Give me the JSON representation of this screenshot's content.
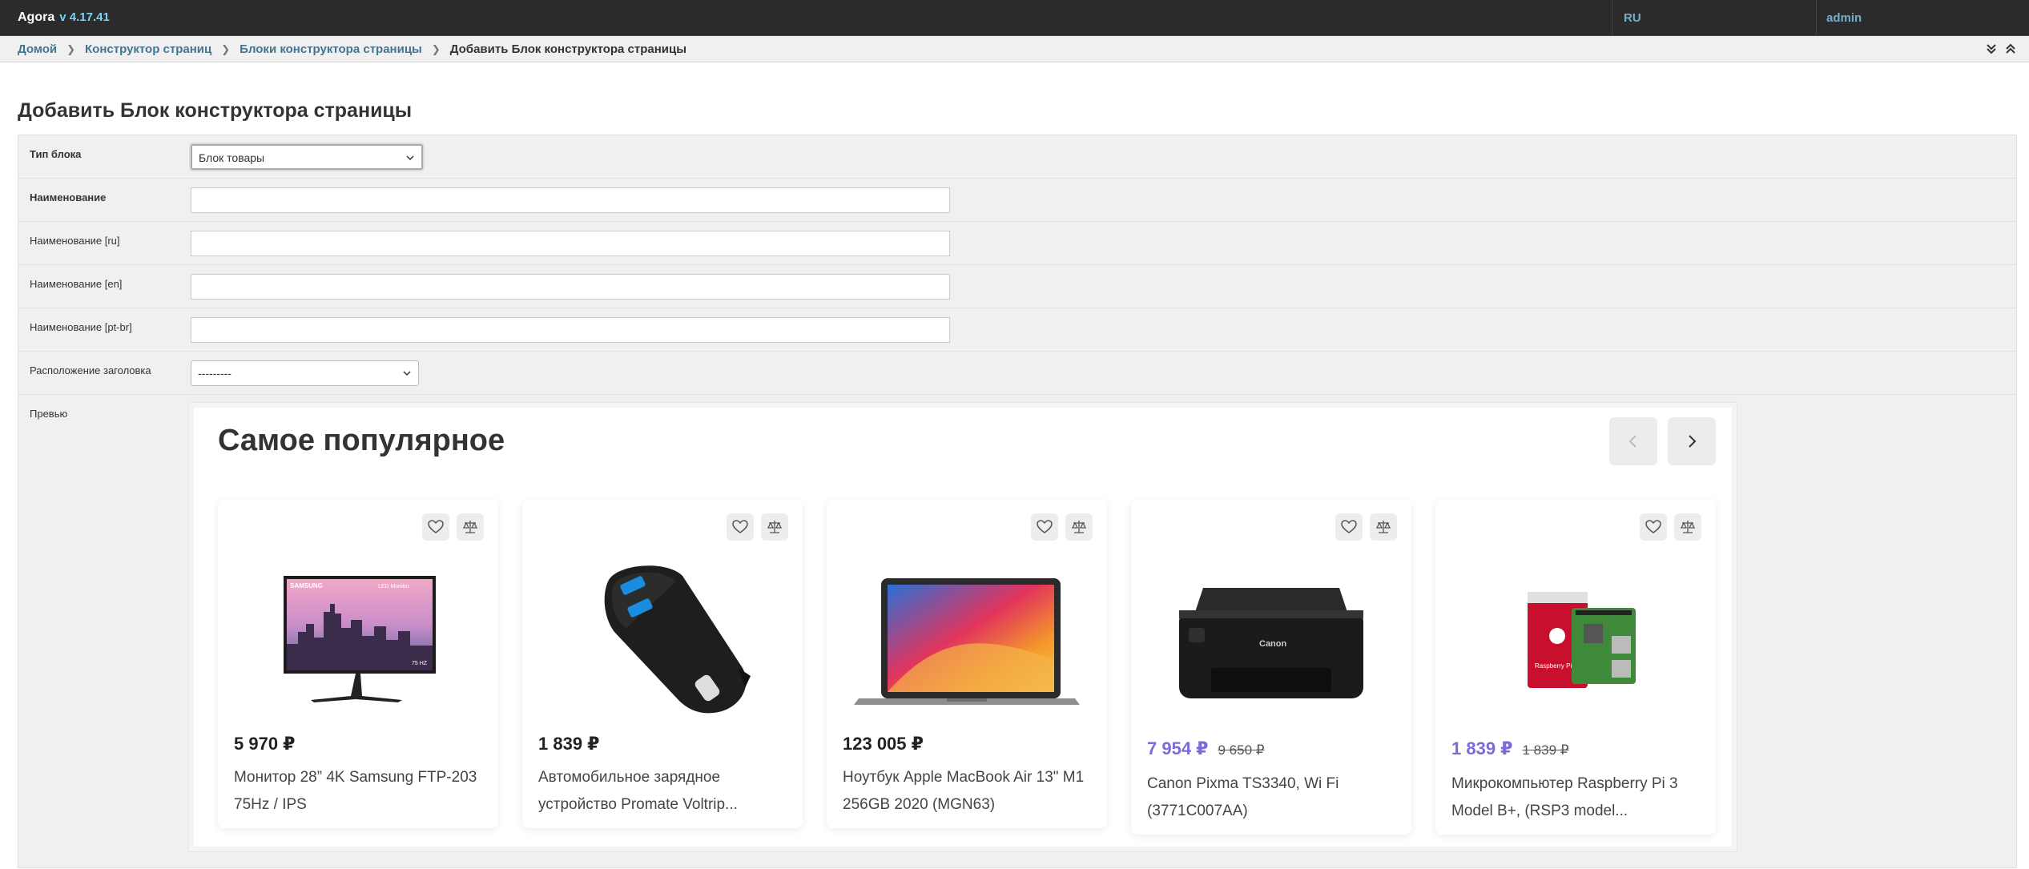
{
  "header": {
    "app": "Agora",
    "version": "v 4.17.41",
    "lang": "RU",
    "user": "admin"
  },
  "breadcrumbs": [
    "Домой",
    "Конструктор страниц",
    "Блоки конструктора страницы"
  ],
  "breadcrumb_current": "Добавить Блок конструктора страницы",
  "page_title": "Добавить Блок конструктора страницы",
  "form": {
    "block_type": {
      "label": "Тип блока",
      "value": "Блок товары"
    },
    "name": {
      "label": "Наименование",
      "value": ""
    },
    "name_ru": {
      "label": "Наименование [ru]",
      "value": ""
    },
    "name_en": {
      "label": "Наименование [en]",
      "value": ""
    },
    "name_ptbr": {
      "label": "Наименование [pt-br]",
      "value": ""
    },
    "title_position": {
      "label": "Расположение заголовка",
      "value": "---------"
    },
    "preview_label": "Превью"
  },
  "preview": {
    "title": "Самое популярное",
    "products": [
      {
        "price": "5 970 ₽",
        "old_price": "",
        "name": "Монитор 28” 4K Samsung FTP-203 75Hz / IPS",
        "image": "monitor-icon"
      },
      {
        "price": "1 839 ₽",
        "old_price": "",
        "name": "Автомобильное зарядное устройство Promate Voltrip...",
        "image": "car-charger-icon"
      },
      {
        "price": "123 005 ₽",
        "old_price": "",
        "name": "Ноутбук Apple MacBook Air 13\" M1 256GB 2020 (MGN63)",
        "image": "laptop-icon"
      },
      {
        "price": "7 954 ₽",
        "old_price": "9 650 ₽",
        "name": "Canon Pixma TS3340, Wi Fi (3771C007AA)",
        "image": "printer-icon"
      },
      {
        "price": "1 839 ₽",
        "old_price": "1 839 ₽",
        "name": "Микрокомпьютер Raspberry Pi 3 Model B+, (RSP3 model...",
        "image": "raspberry-pi-icon"
      }
    ]
  },
  "colors": {
    "topbar": "#2b2b2b",
    "link": "#417690",
    "version": "#79d3f7",
    "sale_price": "#7b6bd9"
  },
  "printed_marks": {
    "monitor_brand": "SAMSUNG",
    "monitor_badge": "LED Monitor",
    "monitor_hz": "75 HZ",
    "printer_brand": "Canon",
    "pi_box": "Raspberry Pi 3"
  }
}
